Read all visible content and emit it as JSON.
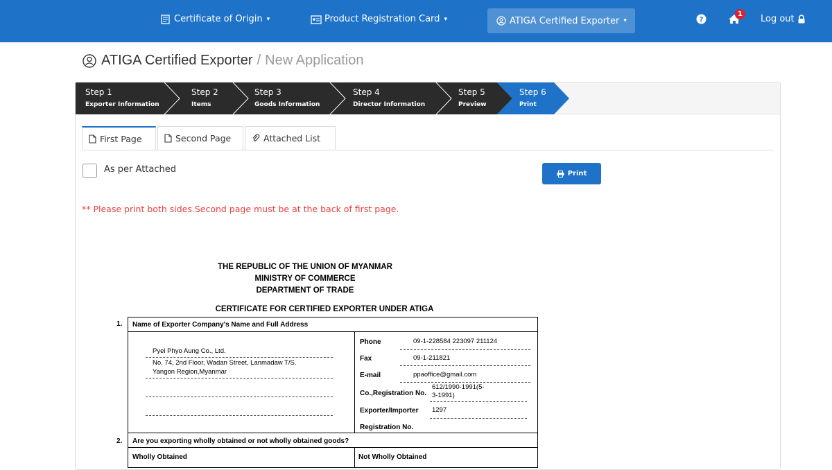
{
  "nav": {
    "items": [
      {
        "label": "Certificate of Origin",
        "icon": "document-icon"
      },
      {
        "label": "Product Registration Card",
        "icon": "id-card-icon"
      },
      {
        "label": "ATIGA Certified Exporter",
        "icon": "user-circle-icon",
        "active": true
      }
    ],
    "help_icon": "question-circle-icon",
    "notifications": {
      "icon": "home-icon",
      "count": "1"
    },
    "logout_label": "Log out",
    "logout_icon": "lock-icon"
  },
  "breadcrumb": {
    "icon": "user-circle-icon",
    "current": "ATIGA Certified Exporter",
    "separator": "/",
    "sub": "New Application"
  },
  "steps": [
    {
      "title": "Step 1",
      "subtitle": "Exporter Information"
    },
    {
      "title": "Step 2",
      "subtitle": "Items"
    },
    {
      "title": "Step 3",
      "subtitle": "Goods Information"
    },
    {
      "title": "Step 4",
      "subtitle": "Director Information"
    },
    {
      "title": "Step 5",
      "subtitle": "Preview"
    },
    {
      "title": "Step 6",
      "subtitle": "Print",
      "active": true
    }
  ],
  "tabs": [
    {
      "label": "First Page",
      "icon": "file-icon",
      "active": true
    },
    {
      "label": "Second Page",
      "icon": "file-icon"
    },
    {
      "label": "Attached List",
      "icon": "paperclip-icon"
    }
  ],
  "attached_checkbox_label": "As per Attached",
  "print_button": "Print",
  "notice": "** Please print both sides.Second page must be at the back of first page.",
  "document": {
    "heading_lines": [
      "THE REPUBLIC OF THE UNION OF MYANMAR",
      "MINISTRY OF COMMERCE",
      "DEPARTMENT OF TRADE"
    ],
    "certificate_title": "CERTIFICATE FOR CERTIFIED EXPORTER UNDER ATIGA",
    "row1_num": "1.",
    "row1_title": "Name of Exporter Company's Name and Full Address",
    "company_name": "Pyei Phyo Aung Co., Ltd.",
    "address_line1": "No. 74, 2nd Floor, Wadan Street, Lanmadaw T/S.",
    "address_line2": "Yangon Region,Myanmar",
    "phone_label": "Phone",
    "phone_value": "09-1-228584 223097 211124",
    "fax_label": "Fax",
    "fax_value": "09-1-211821",
    "email_label": "E-mail",
    "email_value": "ppaoffice@gmail.com",
    "coreg_label": "Co.,Registration No.",
    "coreg_value_1": "612/1990-1991(5-",
    "coreg_value_2": "3-1991)",
    "expimp_label": "Exporter/Importer",
    "expimp_value": "1297",
    "regno_label": "Registration No.",
    "row2_num": "2.",
    "row2_title": "Are you exporting wholly obtained or not wholly obtained goods?",
    "wholly_label": "Wholly Obtained",
    "not_wholly_label": "Not Wholly Obtained"
  },
  "colors": {
    "primary": "#1e73c9",
    "step_dark": "#2b2b2b",
    "notice": "#e8403f",
    "badge": "#d9232d"
  }
}
